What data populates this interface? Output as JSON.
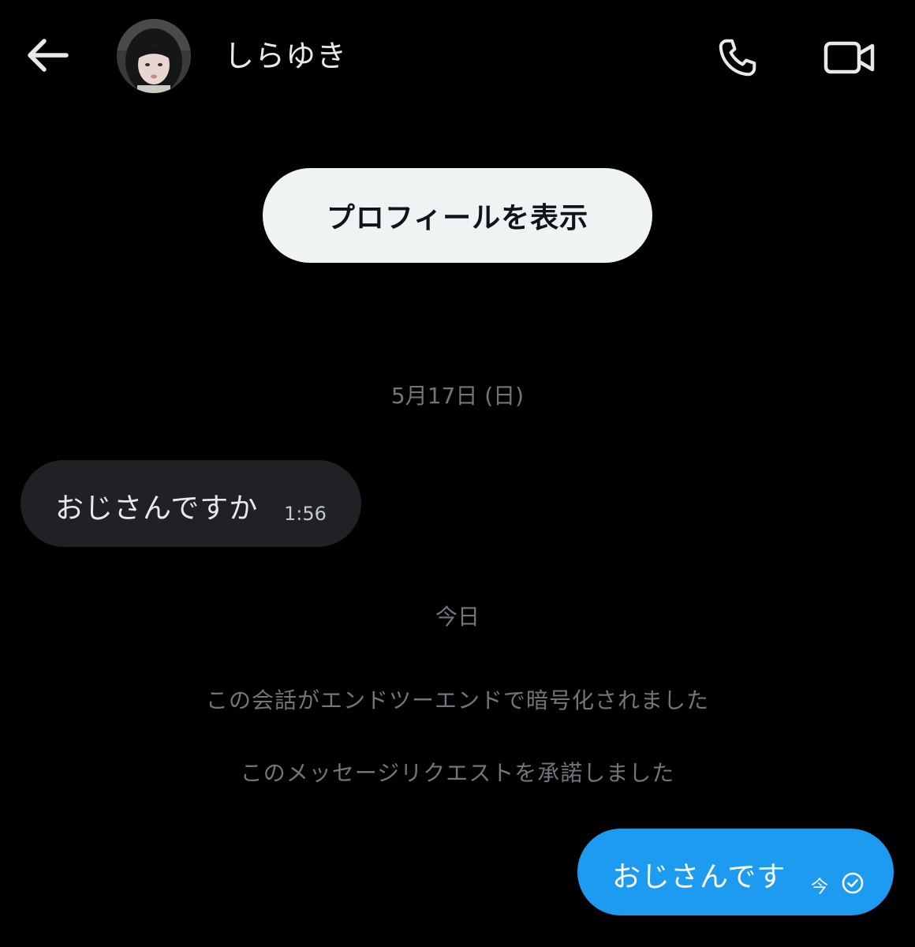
{
  "header": {
    "username": "しらゆき",
    "back_icon": "arrow-left-icon",
    "call_icon": "phone-icon",
    "video_icon": "video-camera-icon"
  },
  "profile_button": {
    "label": "プロフィールを表示"
  },
  "conversation": {
    "date_separator_1": "5月17日 (日)",
    "incoming_message": {
      "text": "おじさんですか",
      "time": "1:56"
    },
    "date_separator_2": "今日",
    "info_encrypted": "この会話がエンドツーエンドで暗号化されました",
    "info_request_accepted": "このメッセージリクエストを承諾しました",
    "outgoing_message": {
      "text": "おじさんです",
      "time": "今",
      "status_icon": "check-circle-icon"
    }
  },
  "colors": {
    "background": "#000000",
    "outgoing_bubble": "#1d9bf0",
    "incoming_bubble": "#1f2124",
    "secondary_text": "#71767b",
    "profile_button_bg": "#eff3f4"
  }
}
